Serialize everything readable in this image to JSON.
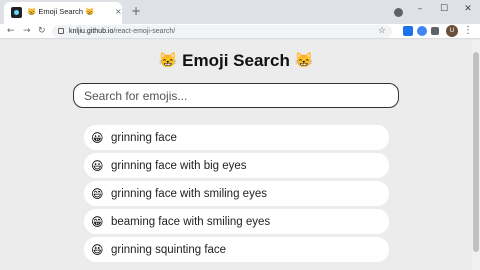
{
  "browser": {
    "tab": {
      "title": "😸 Emoji Search 😸",
      "close": "×"
    },
    "new_tab": "+",
    "window_controls": [
      "–",
      "☐",
      "✕"
    ],
    "nav": {
      "back": "←",
      "forward": "→",
      "reload": "↻"
    },
    "url_host": "knljiu.github.io",
    "url_path": "/react-emoji-search/",
    "star": "☆",
    "avatar_letter": "U",
    "menu": "⋮"
  },
  "page": {
    "heading_emoji_left": "😸",
    "heading_text": "Emoji Search",
    "heading_emoji_right": "😸",
    "search": {
      "placeholder": "Search for emojis...",
      "value": ""
    },
    "results": [
      {
        "emoji": "😀",
        "label": "grinning face"
      },
      {
        "emoji": "😃",
        "label": "grinning face with big eyes"
      },
      {
        "emoji": "😄",
        "label": "grinning face with smiling eyes"
      },
      {
        "emoji": "😁",
        "label": "beaming face with smiling eyes"
      },
      {
        "emoji": "😆",
        "label": "grinning squinting face"
      }
    ]
  },
  "colors": {
    "page_bg": "#ececed",
    "card_bg": "#ffffff",
    "text": "#222222",
    "search_border": "#333333"
  }
}
